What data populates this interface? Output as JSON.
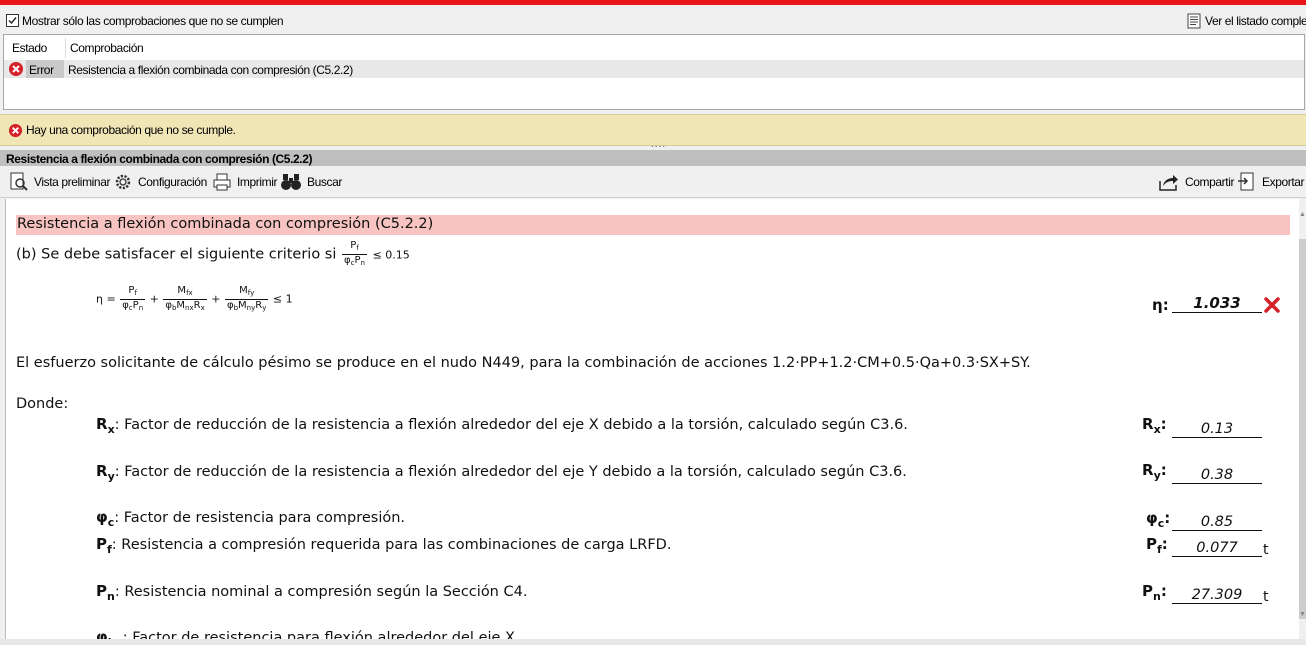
{
  "filter": {
    "checkbox_label": "Mostrar sólo las comprobaciones que no se cumplen",
    "checked": true,
    "view_list_label": "Ver el listado complet"
  },
  "table": {
    "col_estado": "Estado",
    "col_comprobacion": "Comprobación",
    "rows": [
      {
        "estado": "Error",
        "comprobacion": "Resistencia a flexión combinada con compresión (C5.2.2)"
      }
    ]
  },
  "message": "Hay una comprobación que no se cumple.",
  "section_title": "Resistencia a flexión combinada con compresión (C5.2.2)",
  "toolbar": {
    "preview": "Vista preliminar",
    "config": "Configuración",
    "print": "Imprimir",
    "search": "Buscar",
    "share": "Compartir",
    "export": "Exportar"
  },
  "report": {
    "heading": "Resistencia a flexión combinada con compresión (C5.2.2)",
    "criterion_text": "(b) Se debe satisfacer el siguiente criterio si",
    "criterion_limit": "≤ 0.15",
    "formula_limit": "≤ 1",
    "eta_label": "η",
    "eta_value": "1.033",
    "eta_status": "fail",
    "sentence": "El esfuerzo solicitante de cálculo pésimo se produce en el nudo N449, para la combinación de acciones 1.2·PP+1.2·CM+0.5·Qa+0.3·SX+SY.",
    "donde": "Donde:",
    "params": [
      {
        "sym": "R",
        "sub": "x",
        "desc": ": Factor de reducción de la resistencia a flexión alrededor del eje X debido a la torsión, calculado según C3.6.",
        "value": "0.13",
        "unit": ""
      },
      {
        "sym": "R",
        "sub": "y",
        "desc": ": Factor de reducción de la resistencia a flexión alrededor del eje Y debido a la torsión, calculado según C3.6.",
        "value": "0.38",
        "unit": ""
      },
      {
        "sym": "φ",
        "sub": "c",
        "desc": ": Factor de resistencia para compresión.",
        "value": "0.85",
        "unit": ""
      },
      {
        "sym": "P",
        "sub": "f",
        "desc": ": Resistencia a compresión requerida para las combinaciones de carga LRFD.",
        "value": "0.077",
        "unit": "t"
      },
      {
        "sym": "P",
        "sub": "n",
        "desc": ": Resistencia nominal a compresión según la Sección C4.",
        "value": "27.309",
        "unit": "t"
      },
      {
        "sym": "φ",
        "sub": "bx",
        "desc": ": Factor de resistencia para flexión alrededor del eje X.",
        "value": "",
        "unit": ""
      }
    ]
  },
  "colors": {
    "accent_red": "#e8161b",
    "title_bg": "#f7c4c1",
    "message_bg": "#efe5b5"
  }
}
